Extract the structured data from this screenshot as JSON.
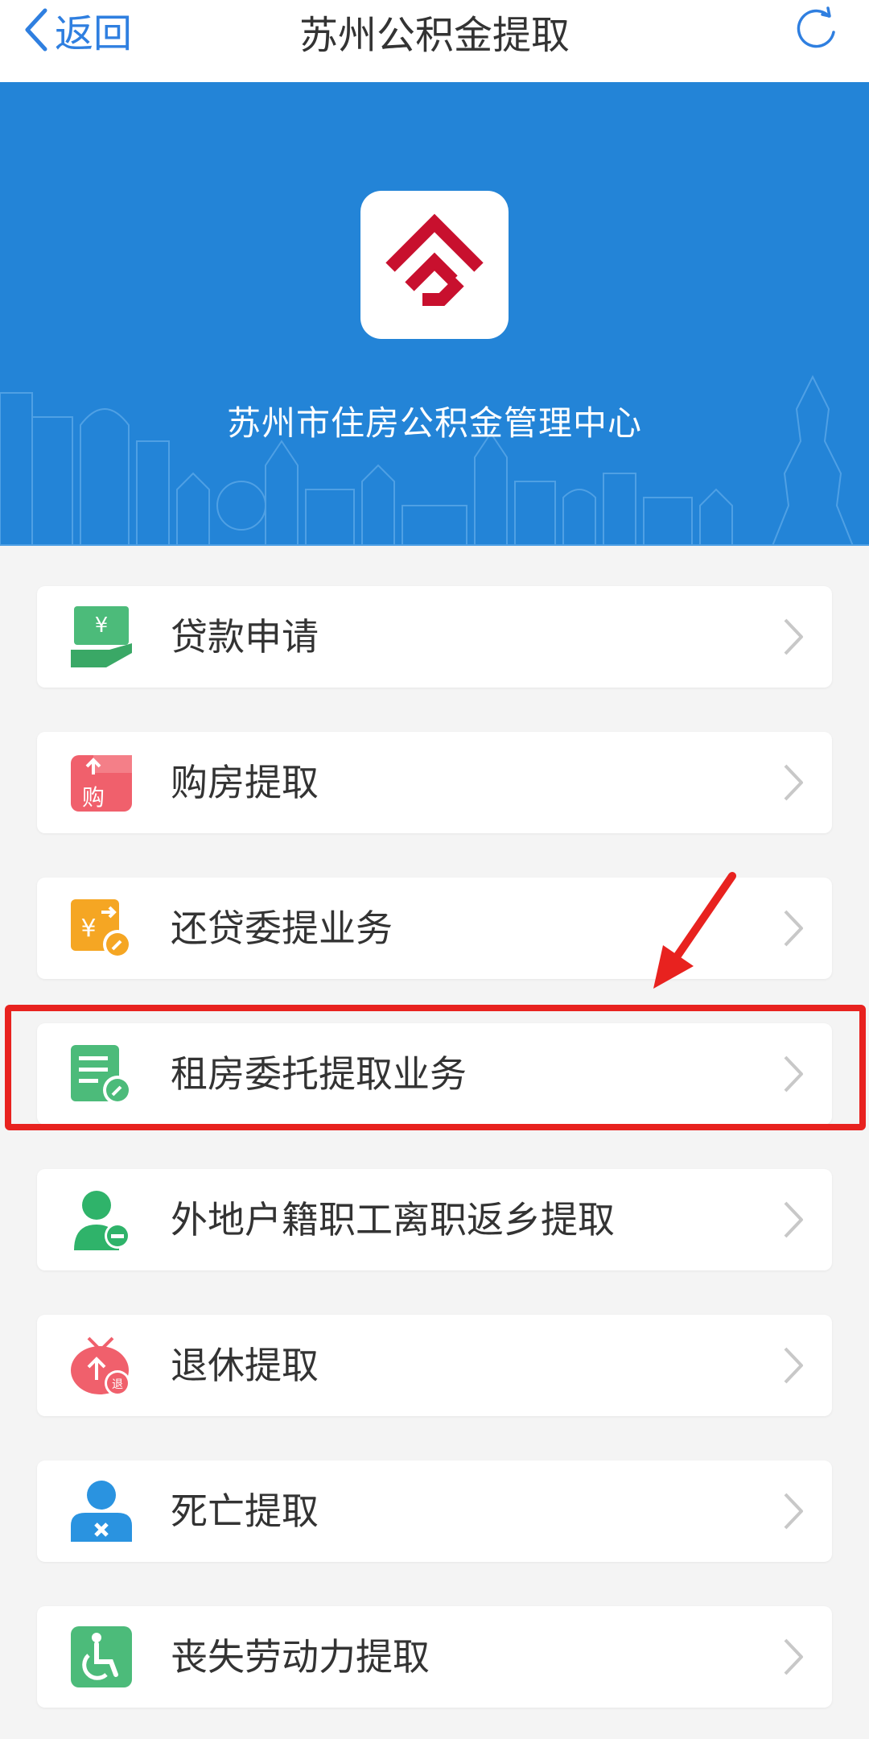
{
  "navbar": {
    "back_label": "返回",
    "title": "苏州公积金提取"
  },
  "banner": {
    "org_name": "苏州市住房公积金管理中心"
  },
  "menu": {
    "items": [
      {
        "label": "贷款申请",
        "icon": "loan-hand-yen-icon",
        "color": "#4cbb7a"
      },
      {
        "label": "购房提取",
        "icon": "purchase-bag-icon",
        "color": "#f0606c"
      },
      {
        "label": "还贷委提业务",
        "icon": "repay-yen-icon",
        "color": "#f5a623"
      },
      {
        "label": "租房委托提取业务",
        "icon": "rent-document-icon",
        "color": "#4cbb7a"
      },
      {
        "label": "外地户籍职工离职返乡提取",
        "icon": "person-minus-icon",
        "color": "#2fb36a"
      },
      {
        "label": "退休提取",
        "icon": "retire-tomato-icon",
        "color": "#f0606c"
      },
      {
        "label": "死亡提取",
        "icon": "person-x-icon",
        "color": "#2a93e0"
      },
      {
        "label": "丧失劳动力提取",
        "icon": "wheelchair-icon",
        "color": "#4cbb7a"
      }
    ]
  },
  "annotation": {
    "highlight_color": "#e8221f",
    "highlighted_item": "租房委托提取业务"
  },
  "colors": {
    "banner": "#2384d7",
    "nav_accent": "#2f7fe0",
    "background": "#f4f4f4"
  }
}
